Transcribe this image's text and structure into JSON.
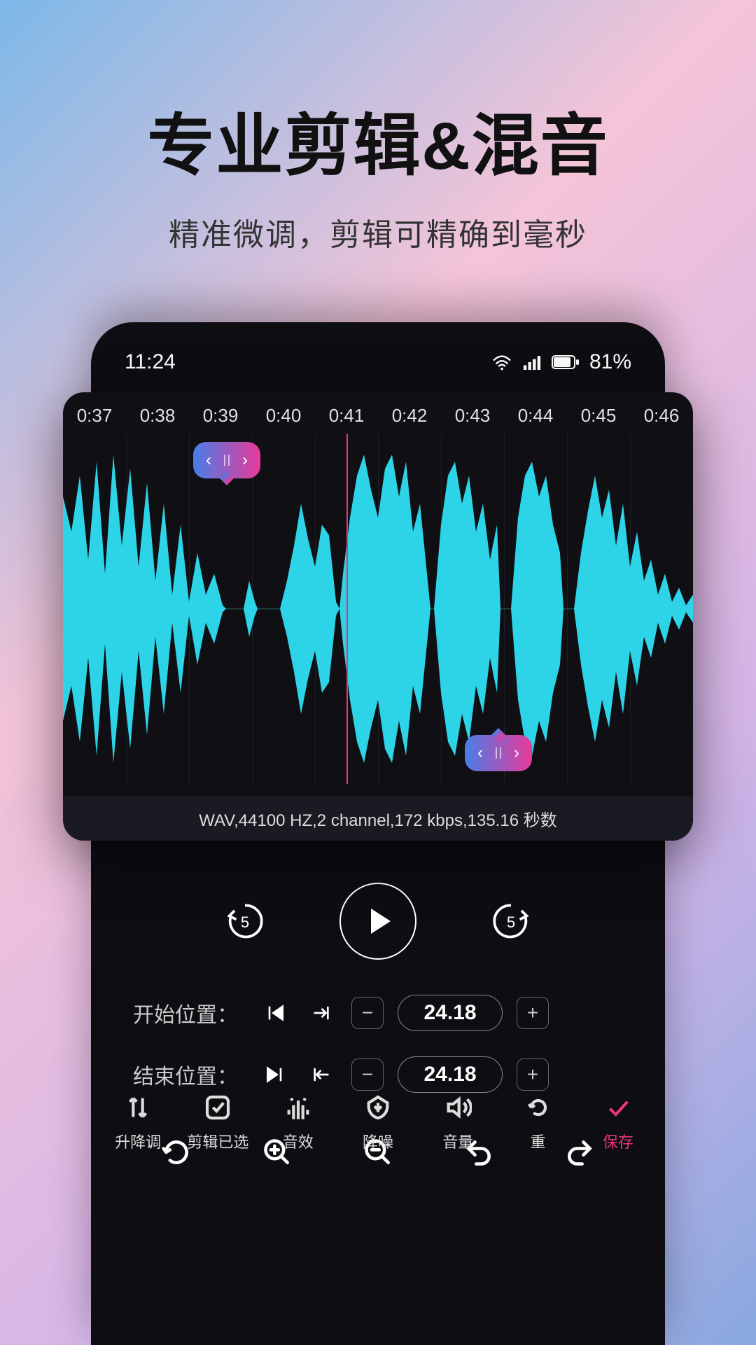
{
  "hero": {
    "title": "专业剪辑&混音",
    "subtitle": "精准微调，剪辑可精确到毫秒"
  },
  "status": {
    "time": "11:24",
    "battery": "81%"
  },
  "ruler": [
    "0:37",
    "0:38",
    "0:39",
    "0:40",
    "0:41",
    "0:42",
    "0:43",
    "0:44",
    "0:45",
    "0:46"
  ],
  "file_info": "WAV,44100 HZ,2 channel,172 kbps,135.16 秒数",
  "skip": {
    "back": "5",
    "fwd": "5"
  },
  "positions": {
    "start": {
      "label": "开始位置：",
      "value": "24.18"
    },
    "end": {
      "label": "结束位置：",
      "value": "24.18"
    }
  },
  "bottom": {
    "pitch": "升降调",
    "clip": "剪辑已选",
    "fx": "音效",
    "noise": "降噪",
    "volume": "音量",
    "reset": "重",
    "save": "保存"
  }
}
